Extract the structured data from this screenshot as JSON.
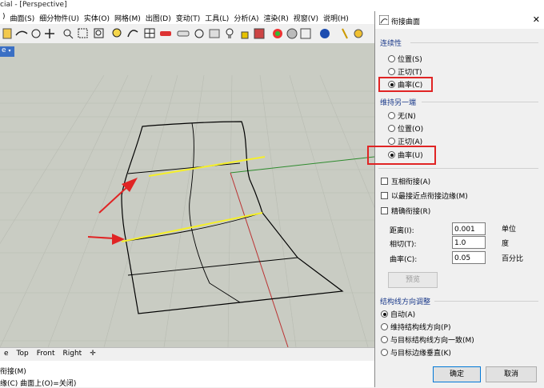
{
  "window": {
    "title": "cial - [Perspective]"
  },
  "menu": [
    "曲面(S)",
    "细分物件(U)",
    "实体(O)",
    "网格(M)",
    "出图(D)",
    "变动(T)",
    "工具(L)",
    "分析(A)",
    "渲染(R)",
    "视窗(V)",
    "说明(H)"
  ],
  "viewport": {
    "tab_label": "e"
  },
  "view_tabs": [
    "e",
    "Top",
    "Front",
    "Right",
    "✛"
  ],
  "command": {
    "line1": "衔接(M)",
    "line2": "缘(C) 曲面上(O)=关闭)"
  },
  "dialog": {
    "title": "衔接曲面",
    "close": "✕",
    "continuity": {
      "label": "连续性",
      "options": [
        "位置(S)",
        "正切(T)",
        "曲率(C)"
      ],
      "selected": 2
    },
    "maintain": {
      "label": "维持另一端",
      "options": [
        "无(N)",
        "位置(O)",
        "正切(A)",
        "曲率(U)"
      ],
      "selected": 3
    },
    "checks": [
      "互相衔接(A)",
      "以最接近点衔接边缘(M)",
      "精确衔接(R)"
    ],
    "fields": [
      {
        "label": "距离(I):",
        "value": "0.001",
        "unit": "单位"
      },
      {
        "label": "相切(T):",
        "value": "1.0",
        "unit": "度"
      },
      {
        "label": "曲率(C):",
        "value": "0.05",
        "unit": "百分比"
      }
    ],
    "preview_button": "预览",
    "iso": {
      "label": "结构线方向调整",
      "options": [
        "自动(A)",
        "维持结构线方向(P)",
        "与目标结构线方向一致(M)",
        "与目标边缘垂直(K)"
      ],
      "selected": 0
    },
    "ok": "确定",
    "cancel": "取消"
  },
  "colors": {
    "highlight": "#e02424",
    "curve": "#f5ef2a",
    "viewport_bg": "#c9ccc3"
  }
}
